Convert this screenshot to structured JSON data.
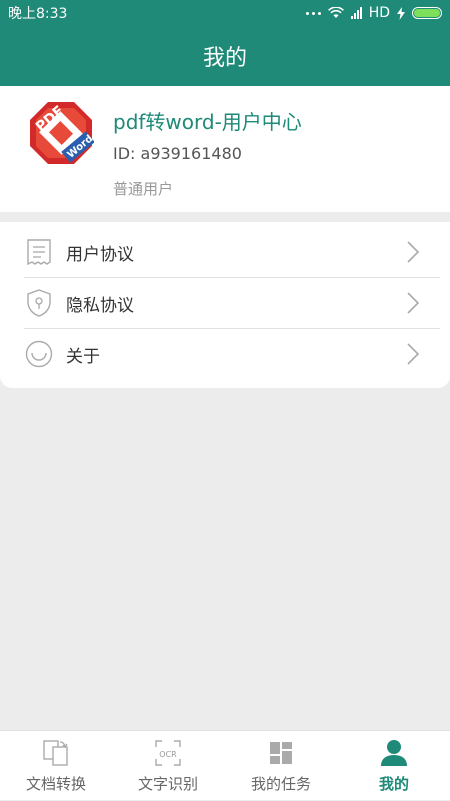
{
  "status_bar": {
    "time": "晚上8:33",
    "network": "HD",
    "icons": [
      "more-dots-icon",
      "wifi-icon",
      "signal-icon",
      "charging-icon",
      "battery-icon"
    ],
    "battery_color": "#7ee05a"
  },
  "header": {
    "title": "我的"
  },
  "profile": {
    "app_name": "pdf转word-用户中心",
    "user_id": "ID: a939161480",
    "user_type": "普通用户",
    "logo_letters_top": "PDF",
    "logo_letters_bottom": "Word"
  },
  "menu": {
    "items": [
      {
        "label": "用户协议",
        "icon": "document-icon"
      },
      {
        "label": "隐私协议",
        "icon": "shield-icon"
      },
      {
        "label": "关于",
        "icon": "smile-icon"
      }
    ]
  },
  "bottom_nav": {
    "items": [
      {
        "label": "文档转换",
        "icon": "convert-document-icon",
        "active": false
      },
      {
        "label": "文字识别",
        "icon": "ocr-icon",
        "ocr_text": "OCR",
        "active": false
      },
      {
        "label": "我的任务",
        "icon": "tasks-grid-icon",
        "active": false
      },
      {
        "label": "我的",
        "icon": "user-icon",
        "active": true
      }
    ]
  },
  "colors": {
    "primary": "#1e8a77",
    "background": "#ececec"
  }
}
